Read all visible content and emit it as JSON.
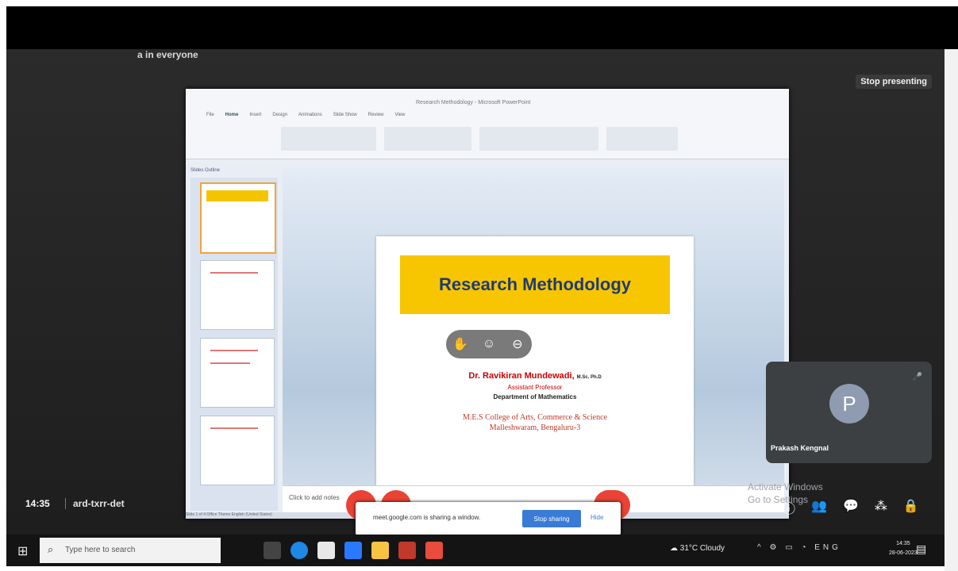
{
  "meet": {
    "presenting_label": "a in everyone",
    "stop_presenting": "Stop presenting",
    "time": "14:35",
    "meeting_code": "ard-txrr-det",
    "participant_initial": "P",
    "participant_name": "Prakash Kengnal",
    "activate_windows": "Activate Windows",
    "activate_sub": "Go to Settings"
  },
  "ppt": {
    "window_title": "Research Methodology - Microsoft PowerPoint",
    "ribbon_tabs": [
      "File",
      "Home",
      "Insert",
      "Design",
      "Animations",
      "Slide Show",
      "Review",
      "View"
    ],
    "pane_tabs": "Slides  Outline",
    "notes_placeholder": "Click to add notes",
    "status": "Slide 1 of 4   Office Theme   English (United States)"
  },
  "slide": {
    "title": "Research Methodology",
    "author": "Dr. Ravikiran Mundewadi,",
    "degree": "M.Sc. Ph.D",
    "role": "Assistant Professor",
    "department": "Department of Mathematics",
    "college_line1": "M.E.S College of Arts, Commerce & Science",
    "college_line2": "Malleshwaram, Bengaluru-3"
  },
  "share_bar": {
    "message": "meet.google.com is sharing a window.",
    "stop_sharing": "Stop sharing",
    "hide": "Hide"
  },
  "taskbar": {
    "search_placeholder": "Type here to search",
    "weather": "31°C  Cloudy",
    "lang": "ENG",
    "clock_time": "14:35",
    "clock_date": "28-06-2023"
  },
  "colors": {
    "slide_title_bg": "#f7c600",
    "slide_title_text": "#1f3b73",
    "end_call": "#ea4335",
    "stop_sharing_btn": "#3a7bd5"
  }
}
